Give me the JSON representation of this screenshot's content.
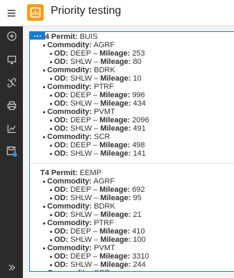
{
  "app": {
    "title": "Priority testing"
  },
  "sidebar": {
    "items": [
      {
        "name": "add-icon"
      },
      {
        "name": "monitor-icon"
      },
      {
        "name": "link-icon"
      },
      {
        "name": "print-icon"
      },
      {
        "name": "chart-icon"
      },
      {
        "name": "save-icon"
      },
      {
        "name": "expand-icon"
      }
    ]
  },
  "labels": {
    "permit": "T4 Permit:",
    "commodity": "Commodity:",
    "od": "OD:",
    "mileage": "Mileage:",
    "dash": " – "
  },
  "permits": [
    {
      "name": "BUIS",
      "commodities": [
        {
          "name": "AGRF",
          "rows": [
            {
              "od": "DEEP",
              "mileage": "253"
            },
            {
              "od": "SHLW",
              "mileage": "80"
            }
          ]
        },
        {
          "name": "BDRK",
          "rows": [
            {
              "od": "SHLW",
              "mileage": "10"
            }
          ]
        },
        {
          "name": "PTRF",
          "rows": [
            {
              "od": "DEEP",
              "mileage": "996"
            },
            {
              "od": "SHLW",
              "mileage": "434"
            }
          ]
        },
        {
          "name": "PVMT",
          "rows": [
            {
              "od": "DEEP",
              "mileage": "2096"
            },
            {
              "od": "SHLW",
              "mileage": "491"
            }
          ]
        },
        {
          "name": "SCR",
          "rows": [
            {
              "od": "DEEP",
              "mileage": "498"
            },
            {
              "od": "SHLW",
              "mileage": "141"
            }
          ]
        }
      ]
    },
    {
      "name": "EEMP",
      "commodities": [
        {
          "name": "AGRF",
          "rows": [
            {
              "od": "DEEP",
              "mileage": "692"
            },
            {
              "od": "SHLW",
              "mileage": "95"
            }
          ]
        },
        {
          "name": "BDRK",
          "rows": [
            {
              "od": "SHLW",
              "mileage": "21"
            }
          ]
        },
        {
          "name": "PTRF",
          "rows": [
            {
              "od": "DEEP",
              "mileage": "410"
            },
            {
              "od": "SHLW",
              "mileage": "100"
            }
          ]
        },
        {
          "name": "PVMT",
          "rows": [
            {
              "od": "DEEP",
              "mileage": "3310"
            },
            {
              "od": "SHLW",
              "mileage": "244"
            }
          ]
        },
        {
          "name": "SCR",
          "rows": []
        }
      ]
    }
  ]
}
